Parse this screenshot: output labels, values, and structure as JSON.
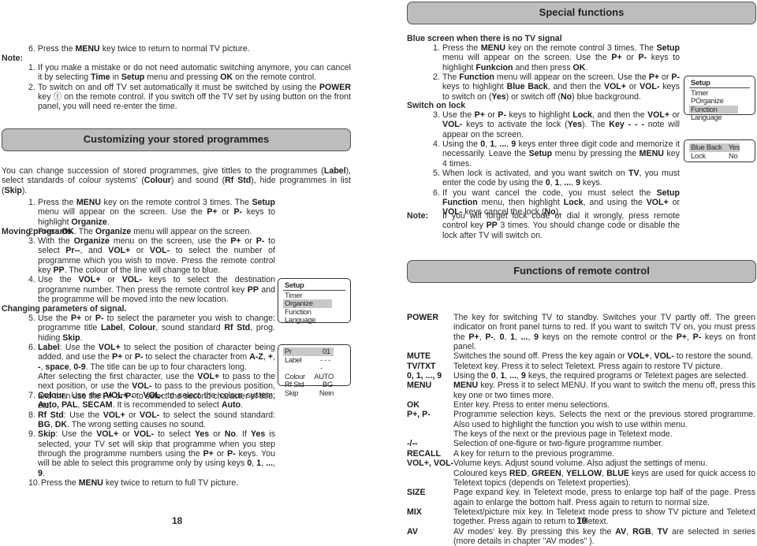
{
  "left_page": {
    "step6": "6. Press the **MENU** key twice to return to normal TV picture.",
    "note_label": "Note:",
    "notes": [
      {
        "num": "1.",
        "text": "If you make a mistake or do not need automatic switching anymore, you can cancel it by selecting **Time** in **Setup** menu and pressing **OK** on the remote control."
      },
      {
        "num": "2.",
        "text": "To switch on and off TV set automatically it must be switched by using the **POWER** key Ⓘ on the remote control. If you switch off the TV set by using  button on the front panel, you will need re-enter the time."
      }
    ],
    "section_title": "Customizing your stored programmes",
    "intro": "You can change succession of stored programmes, give tittles to the programmes (**Label**), select standards of colour systems' (**Colour**) and sound (**Rf Std**), hide programmes in list (**Skip**).",
    "steps_a": [
      {
        "num": "1.",
        "text": "Press the **MENU** key on the remote control 3 times. The **Setup** menu will appear on the screen. Use the **P+** or **P-** keys to highlight **Organize**."
      },
      {
        "num": "2.",
        "text": "Press  **OK**. The **Organize** menu will appear on the screen."
      }
    ],
    "moving_heading": "Moving  programs.",
    "steps_b": [
      {
        "num": "3.",
        "text": "With the **Organize** menu on the screen, use the **P+** or **P-** to select **Pr--**, and **VOL+** or **VOL-** to select the number of programme which you wish to move. Press the remote control key **PP**. The colour of the line will change to blue."
      },
      {
        "num": "4.",
        "text": "Use the **VOL+** or **VOL-** keys to select the destination programme number. Then press the remote control key **PP** and the programme will be moved into the new location."
      }
    ],
    "changing_heading": "Changing  parameters  of  signal.",
    "steps_c": [
      {
        "num": "5.",
        "text": "Use the **P+** or **P-** to select the parameter you wish to change: programme title **Label**, **Colour**, sound standard **Rf Std**, prog. hiding **Skip**."
      },
      {
        "num": "6.",
        "text": "**Label**: Use the **VOL+** to select the position of character being added, and use the **P+** or **P-** to select the character from **A-Z**, **+**, **-**, **space**, **0-9**. The title can be up to four characters long."
      },
      {
        "num": "",
        "text": "After selecting the first character, use the **VOL+** to pass to the next position, or use the **VOL-**  to pass to the previous position, and then use the **P+** or **P-** to select the second character of title, etc."
      }
    ],
    "steps_d": [
      {
        "num": "7.",
        "text": "**Colour**: Use the **VOL+** or **VOL-** to select the colour system: **Auto, PAL**, **SECAM**.  It is recommended to select **Auto**."
      },
      {
        "num": "8.",
        "text": "**Rf Std**: Use the **VOL+** or **VOL-** to select the sound standard: **BG**, **DK**. The wrong setting causes no sound."
      },
      {
        "num": "9.",
        "text": "**Skip**: Use the **VOL+** or **VOL-** to select **Yes** or **No**. If **Yes** is selected, your TV set will skip that programme when you step through the programme numbers using the **P+** or **P-** keys. You will be able to select this programme only by using keys **0**, **1**, **...**, **9**."
      },
      {
        "num": "10.",
        "text": "Press the **MENU** key twice to return to full TV picture."
      }
    ],
    "setup_menu": {
      "title": "Setup",
      "items": [
        "Timer",
        "Organize",
        "Function",
        "Language"
      ],
      "highlighted": "Organize"
    },
    "organize_menu": {
      "rows": [
        [
          "Pr",
          "01"
        ],
        [
          "Label",
          "- - - -"
        ],
        [
          "Colour",
          "AUTO"
        ],
        [
          "Rf Std",
          "BG"
        ],
        [
          "Skip",
          "Nein"
        ]
      ],
      "highlighted": "Pr"
    },
    "page_number": "18"
  },
  "right_page": {
    "section_title": "Special functions",
    "blue_heading": "Blue screen when there is no TV signal",
    "blue_steps": [
      {
        "num": "1.",
        "text": "Press the **MENU** key on the remote control 3 times. The **Setup**  menu will appear on the screen. Use the **P+** or **P-** keys to highlight **Funkcion** and then press **OK**."
      },
      {
        "num": "2.",
        "text": "The **Function** menu will appear on the screen. Use the **P+** or **P-** keys to highlight **Blue Back**, and then the **VOL+** or **VOL-** keys to switch on (**Yes**) or switch off (**No**) blue background."
      }
    ],
    "lock_heading": "Switch on lock",
    "lock_steps": [
      {
        "num": "3.",
        "text": "Use the **P+** or **P-** keys to highlight **Lock**, and then the **VOL+** or **VOL-** keys to activate the lock (**Yes**). The **Key - - -** note will appear on the screen."
      },
      {
        "num": "4.",
        "text": "Using the **0**, **1**, **...**, **9** keys enter three digit code and memorize it necessarily. Leave the **Setup** menu by pressing the **MENU** key 4 times."
      },
      {
        "num": "5.",
        "text": "When lock is activated, and you want switch on **TV**, you must enter the code by using the **0**, **1**, **...**, **9** keys."
      },
      {
        "num": "6.",
        "text": "If you want cancel the code, you must select the **Setup Function** menu, then highlight **Lock**, and using the **VOL+** or **VOL-** keys cancel the lock (**No**)."
      }
    ],
    "note_label": "Note:",
    "note_text": "If you will forget lock code or dial it wrongly, press remote control key **PP** 3 times. You should change code or disable the lock after TV will switch on.",
    "setup_menu": {
      "title": "Setup",
      "items": [
        "Timer",
        "POrganize",
        "Function",
        "Language"
      ],
      "highlighted": "Function"
    },
    "function_menu": {
      "rows": [
        [
          "Blue Back",
          "Yes"
        ],
        [
          "Lock",
          "No"
        ]
      ],
      "highlighted": "Blue Back"
    },
    "remote_title": "Functions of remote control",
    "remote_keys": [
      {
        "key": "POWER",
        "text": "The key for switching TV to standby. Switches your TV partly off. The green indicator on front  panel turns to red. If you want to switch TV on, you must press the **P+**, **P-**, **0**, **1**, **...**, **9** keys on the remote control or the **P+**, **P-** keys on front panel."
      },
      {
        "key": "MUTE",
        "text": "Switches the sound off. Press the key again or **VOL+**, **VOL-** to restore the sound."
      },
      {
        "key": "TV/TXT",
        "text": "Teletext key. Press it to select Teletext. Press again to restore TV picture."
      },
      {
        "key": "0, 1, ..., 9",
        "text": "Using the **0**, **1**, **...**, **9** keys, the required programs or Teletext pages are selected."
      },
      {
        "key": "MENU",
        "text": "**MENU** key. Press it to select MENU. If you want to switch the menu off, press this key one or two times more."
      },
      {
        "key": "OK",
        "text": "Enter key. Press to enter menu selections."
      },
      {
        "key": "P+, P-",
        "text": "Programme selection keys. Selects the next or the previous stored programme. Also used to highlight the function you wish to use within menu."
      },
      {
        "key": "",
        "text": "The keys of the next or the previous page in Teletext mode."
      },
      {
        "key": "-/--",
        "text": "Selection of one-figure or two-figure programme number."
      },
      {
        "key": "RECALL",
        "text": "A key for return to the previous programme."
      },
      {
        "key": "VOL+, VOL-",
        "text": "Volume keys. Adjust sound volume. Also adjust the settings of menu."
      },
      {
        "key": "",
        "text": "Coloured keys **RED**, **GREEN**, **YELLOW**, **BLUE** keys are used for quick access to Teletext topics (depends on Teletext properties)."
      },
      {
        "key": "SIZE",
        "text": "Page expand key. In Teletext mode, press to enlarge top half of the page. Press again to enlarge the bottom half. Press again to return to normal size."
      },
      {
        "key": "MIX",
        "text": "Teletext/picture mix key. In Teletext mode press to show TV picture and Teletext together. Press again to return to Teletext."
      },
      {
        "key": "AV",
        "text": "AV modes' key. By pressing this key the **AV**, **RGB**, **TV** are selected in series (more details in chapter \"AV modes\" )."
      }
    ],
    "page_number": "19"
  }
}
